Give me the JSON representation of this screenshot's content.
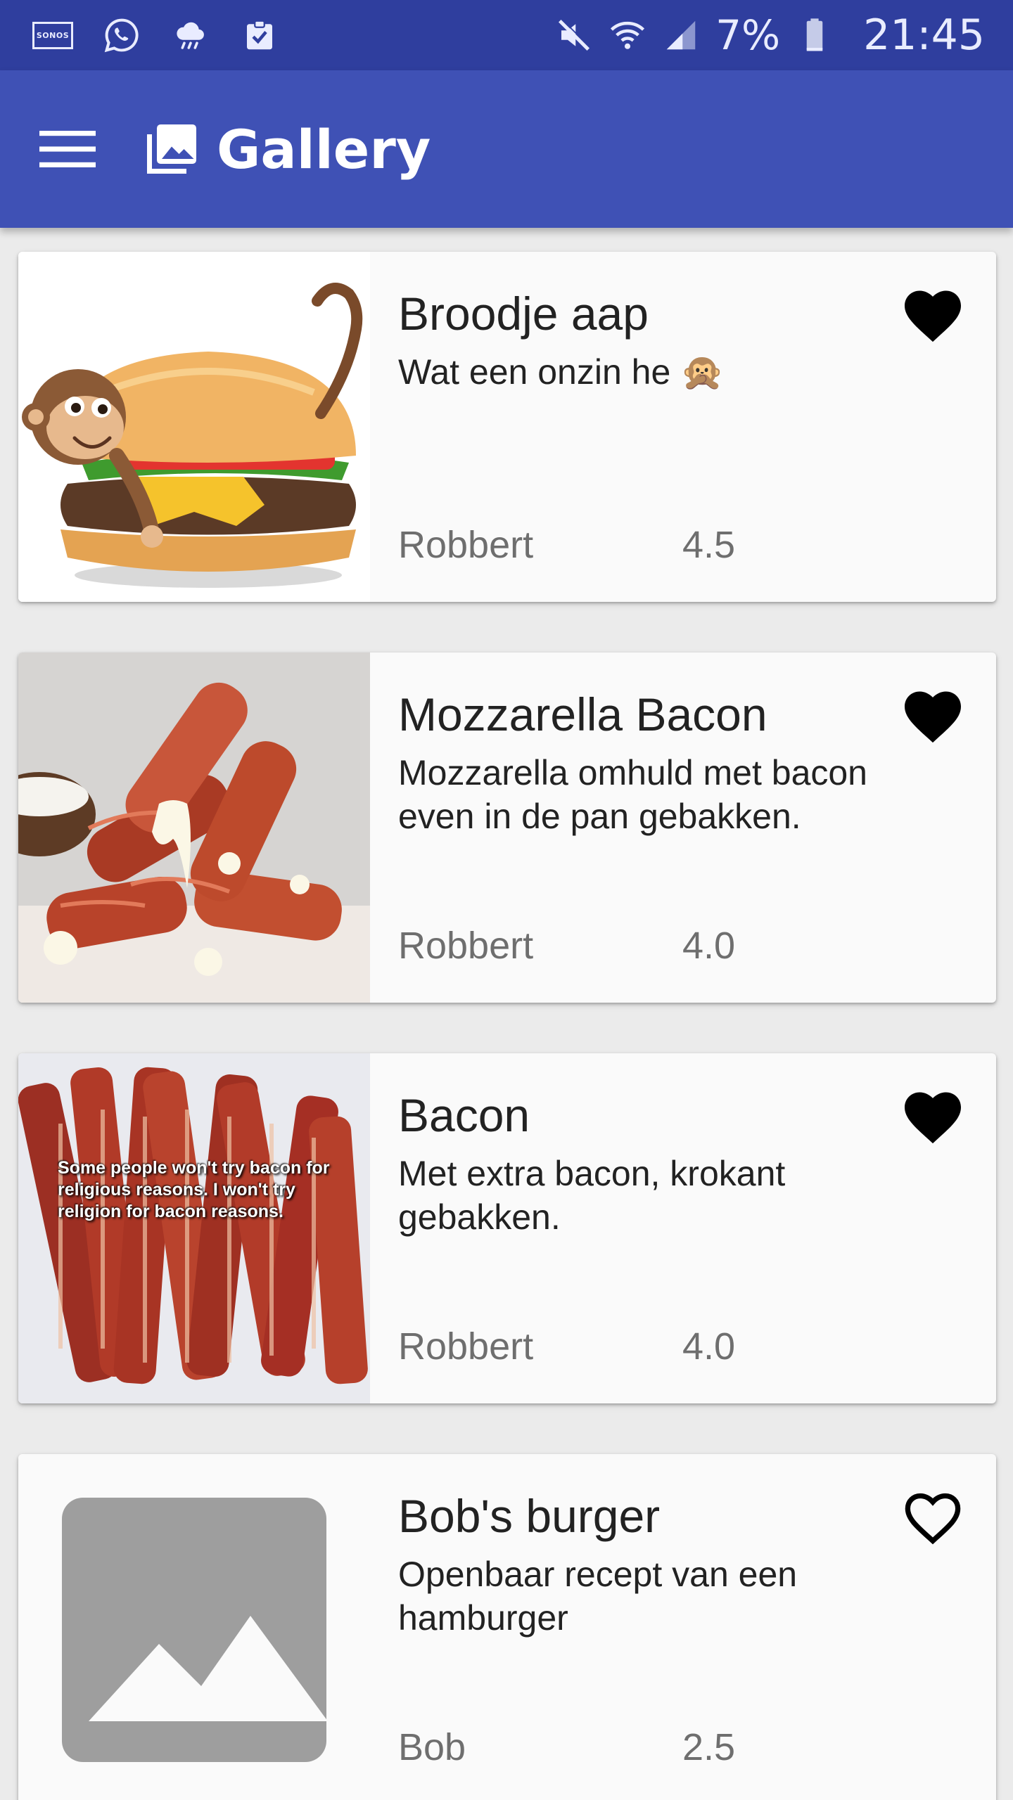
{
  "status_bar": {
    "left_icons": [
      "sonos-icon",
      "whatsapp-icon",
      "weather-icon",
      "clipboard-check-icon"
    ],
    "sonos_label": "SONOS",
    "right_icons": [
      "mute-icon",
      "wifi-icon",
      "signal-icon",
      "battery-icon"
    ],
    "battery": "7%",
    "time": "21:45"
  },
  "app_bar": {
    "title": "Gallery",
    "menu_icon": "menu-icon",
    "title_icon": "gallery-icon",
    "color": "#3f51b5"
  },
  "cards": [
    {
      "title": "Broodje aap",
      "description": "Wat een onzin he 🙊",
      "author": "Robbert",
      "rating": "4.5",
      "favorite": true,
      "image": "monkey-burger"
    },
    {
      "title": "Mozzarella Bacon",
      "description": "Mozzarella omhuld met bacon even in de pan gebakken.",
      "author": "Robbert",
      "rating": "4.0",
      "favorite": true,
      "image": "mozzarella-bacon"
    },
    {
      "title": "Bacon",
      "description": "Met extra bacon, krokant gebakken.",
      "author": "Robbert",
      "rating": "4.0",
      "favorite": true,
      "image": "bacon-strips",
      "image_caption": "Some people won't try bacon for religious reasons. I won't try religion for bacon reasons."
    },
    {
      "title": "Bob's burger",
      "description": "Openbaar recept van een hamburger",
      "author": "Bob",
      "rating": "2.5",
      "favorite": false,
      "image": "placeholder"
    }
  ]
}
